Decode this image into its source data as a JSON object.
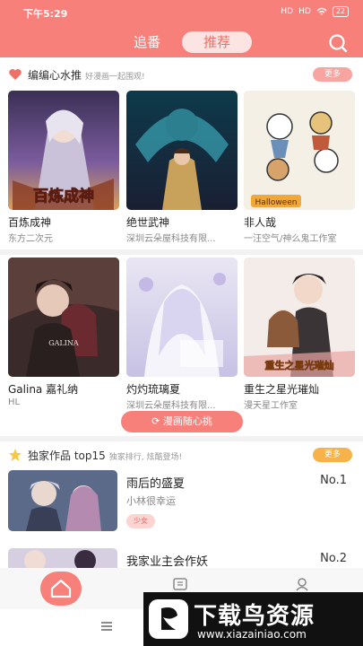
{
  "status_bar": {
    "time": "下午5:29",
    "signal1": "HD",
    "signal2": "HD",
    "battery": "22"
  },
  "header": {
    "tabs": [
      {
        "label": "追番"
      },
      {
        "label": "推荐"
      }
    ]
  },
  "editor_pick": {
    "title": "编编心水推",
    "subtitle": "好漫画一起围观!",
    "more_label": "更多",
    "items": [
      {
        "name": "百炼成神",
        "author": "东方二次元",
        "cover_text": "百炼成神"
      },
      {
        "name": "绝世武神",
        "author": "深圳云朵屋科技有限..."
      },
      {
        "name": "非人哉",
        "author": "一汪空气/神么鬼工作室",
        "cover_text": "Halloween"
      },
      {
        "name": "Galina 嘉礼纳",
        "author": "HL",
        "cover_text": "GALINA"
      },
      {
        "name": "灼灼琉璃夏",
        "author": "深圳云朵屋科技有限..."
      },
      {
        "name": "重生之星光璀灿",
        "author": "漫天星工作室",
        "cover_text": "重生之星光璀灿"
      }
    ],
    "random_label": "漫画随心挑"
  },
  "exclusive": {
    "title": "独家作品 top15",
    "subtitle": "独家排行, 炫酷登场!",
    "more_label": "更多",
    "items": [
      {
        "title": "雨后的盛夏",
        "author": "小林很幸运",
        "tag": "少女",
        "rank": "No.1"
      },
      {
        "title": "我家业主会作妖",
        "rank": "No.2"
      }
    ]
  },
  "watermark": {
    "text": "下载鸟资源",
    "url": "www.xiazainiao.com"
  },
  "colors": {
    "accent": "#f8807a",
    "accent_light": "#fce4e2",
    "more_orange": "#f7b24a"
  }
}
